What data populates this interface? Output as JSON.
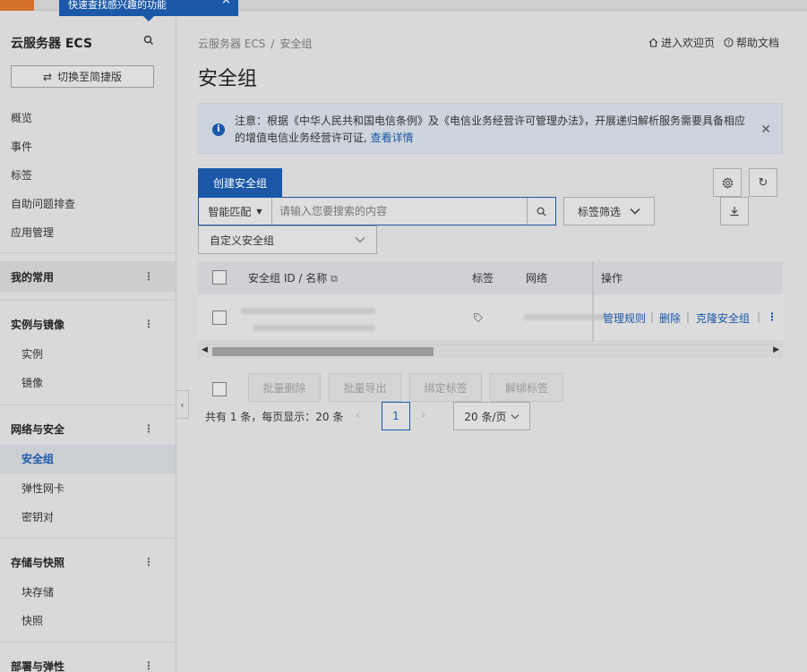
{
  "topbar": {
    "tooltip_text": "快速查找感兴趣的功能"
  },
  "sidebar": {
    "title": "云服务器 ECS",
    "switch_label": "切换至简捷版",
    "top_items": [
      {
        "label": "概览"
      },
      {
        "label": "事件"
      },
      {
        "label": "标签"
      },
      {
        "label": "自助问题排查"
      },
      {
        "label": "应用管理"
      }
    ],
    "groups": [
      {
        "label": "我的常用",
        "items": []
      },
      {
        "label": "实例与镜像",
        "items": [
          {
            "label": "实例"
          },
          {
            "label": "镜像"
          }
        ]
      },
      {
        "label": "网络与安全",
        "items": [
          {
            "label": "安全组"
          },
          {
            "label": "弹性网卡"
          },
          {
            "label": "密钥对"
          }
        ]
      },
      {
        "label": "存储与快照",
        "items": [
          {
            "label": "块存储"
          },
          {
            "label": "快照"
          }
        ]
      },
      {
        "label": "部署与弹性",
        "items": []
      }
    ]
  },
  "breadcrumb": {
    "root": "云服务器 ECS",
    "sep": "/",
    "current": "安全组"
  },
  "top_links": {
    "welcome": "进入欢迎页",
    "help": "帮助文档"
  },
  "page_title": "安全组",
  "notice": {
    "text": "注意：根据《中华人民共和国电信条例》及《电信业务经营许可管理办法》，开展递归解析服务需要具备相应的增值电信业务经营许可证,",
    "link": "查看详情"
  },
  "toolbar": {
    "create_label": "创建安全组",
    "search_mode": "智能匹配",
    "search_placeholder": "请输入您要搜索的内容",
    "tag_filter_label": "标签筛选",
    "custom_select_label": "自定义安全组"
  },
  "table": {
    "headers": {
      "id_name": "安全组 ID / 名称",
      "tags": "标签",
      "network": "网络",
      "ops": "操作"
    },
    "row_ops": {
      "manage": "管理规则",
      "delete": "删除",
      "clone": "克隆安全组"
    }
  },
  "batch": {
    "delete": "批量删除",
    "export": "批量导出",
    "bind_tag": "绑定标签",
    "unbind_tag": "解绑标签"
  },
  "pager": {
    "total_text": "共有 1 条，每页显示：20 条",
    "current_page": "1",
    "page_size": "20 条/页"
  },
  "colors": {
    "primary": "#1b58a8",
    "accent_orange": "#d4702c"
  }
}
